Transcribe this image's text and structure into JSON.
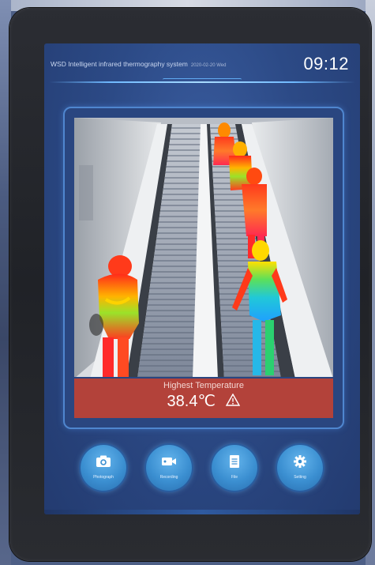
{
  "header": {
    "title": "WSD Intelligent infrared thermography system",
    "subtitle": "2020-02-20 Wed",
    "time": "09:12"
  },
  "reading": {
    "label": "Highest  Temperature",
    "value": "38.4℃"
  },
  "buttons": [
    {
      "label": "Photograph",
      "icon": "camera-icon"
    },
    {
      "label": "Recording",
      "icon": "video-camera-icon"
    },
    {
      "label": "File",
      "icon": "file-icon"
    },
    {
      "label": "Setting",
      "icon": "gear-icon"
    }
  ],
  "colors": {
    "screen": "#2c4a86",
    "alert_panel": "#b3423a",
    "button": "#3b8fd1",
    "accent_line": "#6fb9ff"
  }
}
